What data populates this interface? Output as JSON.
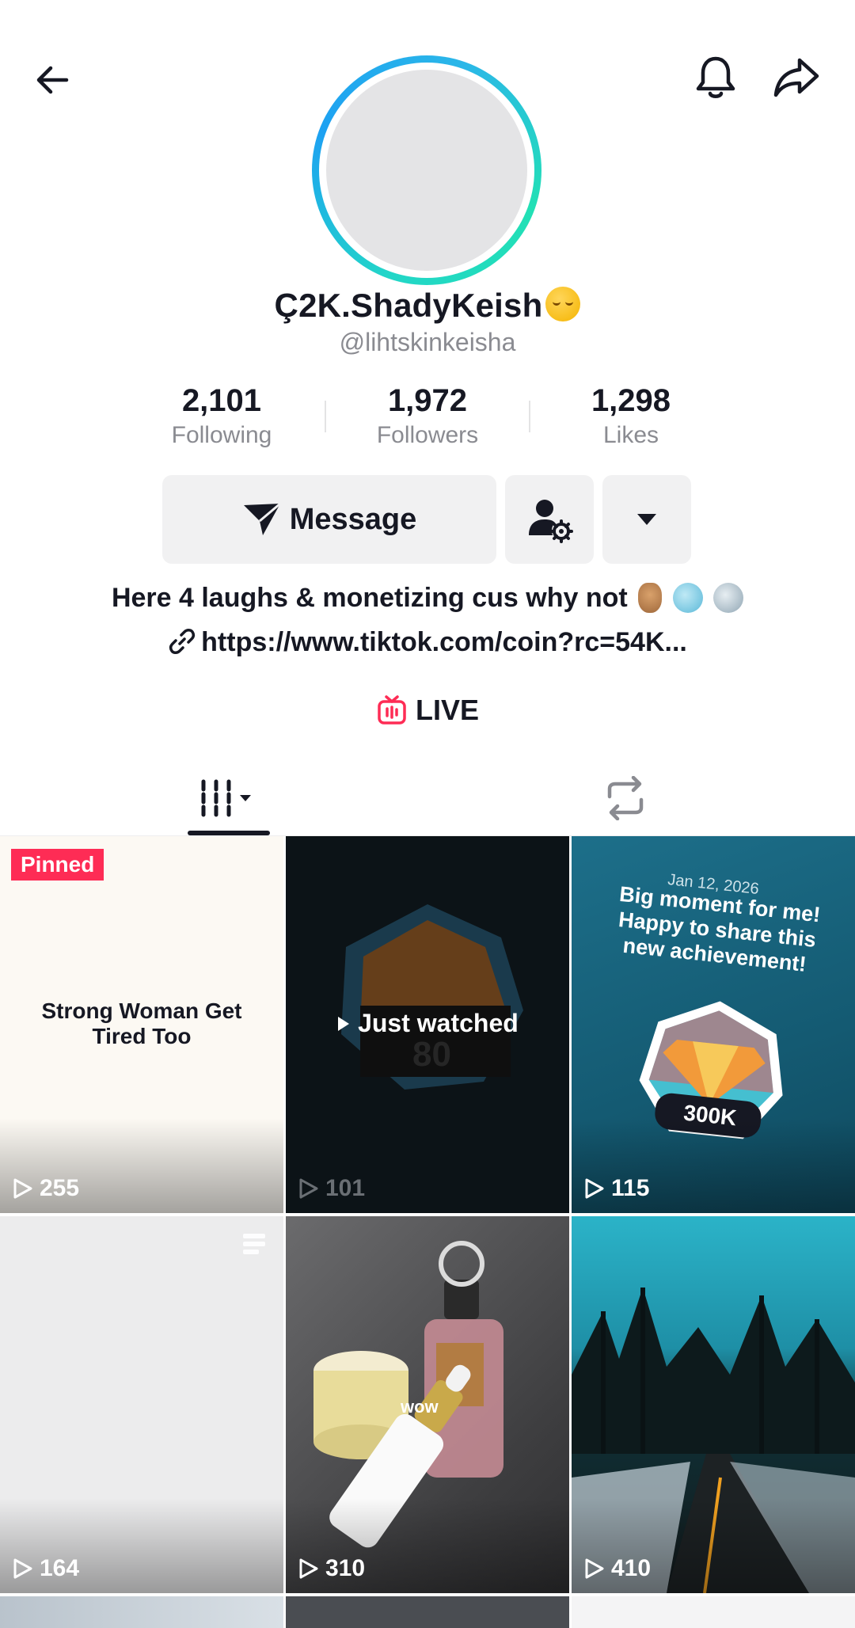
{
  "profile": {
    "display_name": "Ç2K.ShadyKeish",
    "display_name_emoji": "relieved-face-emoji",
    "handle": "@lihtskinkeisha",
    "bio": "Here 4 laughs & monetizing cus why not",
    "bio_emojis": [
      "fingers-crossed-emoji",
      "dolphin-emoji",
      "shark-emoji"
    ],
    "link": "https://www.tiktok.com/coin?rc=54K..."
  },
  "stats": [
    {
      "value": "2,101",
      "label": "Following"
    },
    {
      "value": "1,972",
      "label": "Followers"
    },
    {
      "value": "1,298",
      "label": "Likes"
    }
  ],
  "actions": {
    "message_label": "Message",
    "follow_settings_icon": "person-gear-icon",
    "more_icon": "caret-down-icon"
  },
  "live_label": "LIVE",
  "tabs": [
    {
      "name": "videos",
      "icon": "grid-icon",
      "active": true
    },
    {
      "name": "reposts",
      "icon": "repost-icon",
      "active": false
    }
  ],
  "videos": [
    {
      "views": "255",
      "badge": "Pinned",
      "caption": "Strong Woman Get Tired Too"
    },
    {
      "views": "101",
      "overlay": "Just watched"
    },
    {
      "views": "115",
      "date": "Jan 12, 2026",
      "caption": "Big moment for me! Happy to share this new achievement!",
      "badge_text": "300K"
    },
    {
      "views": "164"
    },
    {
      "views": "310",
      "text": "wow"
    },
    {
      "views": "410"
    }
  ],
  "colors": {
    "accent": "#fe2c55",
    "live": "#fe2c55",
    "ring_start": "#1da1f2",
    "ring_end": "#22e0b5",
    "text_primary": "#161823",
    "text_secondary": "#8a8b91"
  }
}
